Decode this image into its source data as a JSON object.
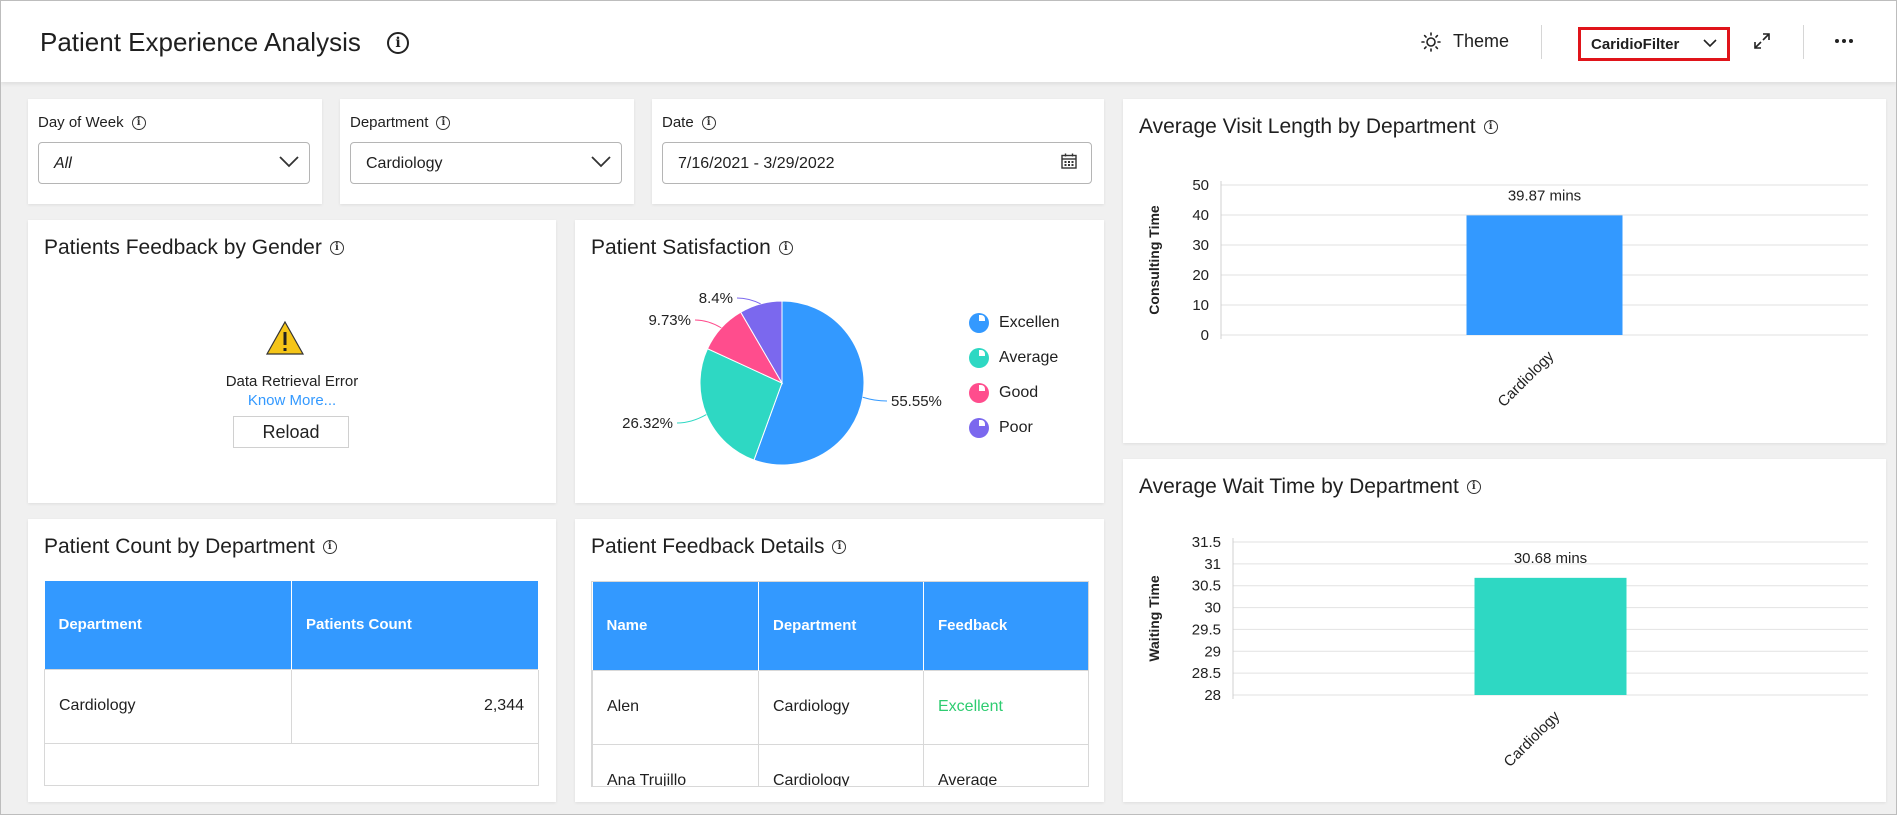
{
  "header": {
    "title": "Patient Experience Analysis",
    "theme_label": "Theme",
    "filter_label": "CaridioFilter"
  },
  "filters": {
    "day_of_week": {
      "label": "Day of Week",
      "value": "All"
    },
    "department": {
      "label": "Department",
      "value": "Cardiology"
    },
    "date": {
      "label": "Date",
      "value": "7/16/2021 - 3/29/2022"
    }
  },
  "feedback_by_gender": {
    "title": "Patients Feedback by Gender",
    "error_text": "Data Retrieval Error",
    "know_more": "Know More...",
    "reload": "Reload"
  },
  "satisfaction": {
    "title": "Patient Satisfaction",
    "colors": {
      "Excellent": "#3399ff",
      "Average": "#2ed8c3",
      "Good": "#ff4d8d",
      "Poor": "#7b68ee"
    }
  },
  "patient_count": {
    "title": "Patient Count by Department",
    "columns": [
      "Department",
      "Patients Count"
    ],
    "rows": [
      [
        "Cardiology",
        "2,344"
      ]
    ]
  },
  "feedback_details": {
    "title": "Patient Feedback Details",
    "columns": [
      "Name",
      "Department",
      "Feedback"
    ],
    "rows": [
      [
        "Alen",
        "Cardiology",
        "Excellent"
      ],
      [
        "Ana Trujillo",
        "Cardiology",
        "Average"
      ]
    ],
    "excellent_color": "#2ecc71"
  },
  "visit_length": {
    "title": "Average Visit Length by Department"
  },
  "wait_time": {
    "title": "Average Wait Time by Department"
  },
  "chart_data": [
    {
      "type": "pie",
      "title": "Patient Satisfaction",
      "categories": [
        "Excellen",
        "Average",
        "Good",
        "Poor"
      ],
      "values": [
        55.55,
        26.32,
        9.73,
        8.4
      ],
      "data_labels": [
        "55.55%",
        "26.32%",
        "9.73%",
        "8.4%"
      ],
      "legend": "right"
    },
    {
      "type": "bar",
      "title": "Average Visit Length by Department",
      "categories": [
        "Cardiology"
      ],
      "values": [
        39.87
      ],
      "data_labels": [
        "39.87 mins"
      ],
      "ylabel": "Consulting Time",
      "ylim": [
        0,
        50
      ],
      "yticks": [
        "50",
        "40",
        "30",
        "20",
        "10",
        "0"
      ],
      "color": "#3399ff",
      "grid": true
    },
    {
      "type": "bar",
      "title": "Average Wait Time by Department",
      "categories": [
        "Cardiology"
      ],
      "values": [
        30.68
      ],
      "data_labels": [
        "30.68 mins"
      ],
      "ylabel": "Waiting Time",
      "ylim": [
        28,
        31.5
      ],
      "yticks": [
        "31.5",
        "31",
        "30.5",
        "30",
        "29.5",
        "29",
        "28.5",
        "28"
      ],
      "color": "#2ed8c3",
      "grid": true
    }
  ]
}
